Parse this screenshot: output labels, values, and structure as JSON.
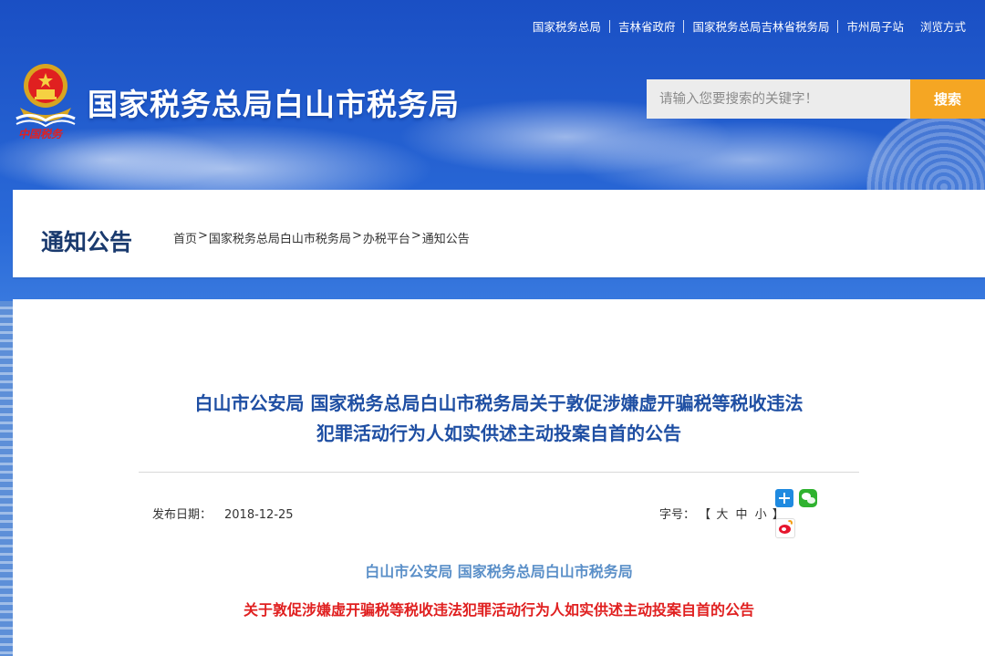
{
  "top_links": [
    "国家税务总局",
    "吉林省政府",
    "国家税务总局吉林省税务局",
    "市州局子站",
    "浏览方式"
  ],
  "header": {
    "site_title": "国家税务总局白山市税务局",
    "logo_caption": "中国税务",
    "logo_icon": "national-emblem-icon"
  },
  "search": {
    "placeholder": "请输入您要搜索的关键字！",
    "button_label": "搜索"
  },
  "section": {
    "title": "通知公告",
    "breadcrumb": [
      "首页",
      "国家税务总局白山市税务局",
      "办税平台",
      "通知公告"
    ],
    "breadcrumb_separator": ">"
  },
  "article": {
    "title_line1": "白山市公安局 国家税务总局白山市税务局关于敦促涉嫌虚开骗税等税收违法",
    "title_line2": "犯罪活动行为人如实供述主动投案自首的公告",
    "date_label": "发布日期：",
    "date_value": "2018-12-25",
    "font_size_label": "字号：",
    "font_size_open": "【",
    "font_size_options": [
      "大",
      "中",
      "小"
    ],
    "font_size_close": "】",
    "share_icons": [
      "share-plus-icon",
      "wechat-icon",
      "weibo-icon"
    ],
    "body_subtitle": "白山市公安局 国家税务总局白山市税务局",
    "body_heading": "关于敦促涉嫌虚开骗税等税收违法犯罪活动行为人如实供述主动投案自首的公告"
  },
  "colors": {
    "banner_blue": "#1a4fc4",
    "search_button": "#f5a623",
    "title_blue": "#1f4fa3",
    "subtitle_blue": "#5a8fc8",
    "heading_red": "#e02020",
    "section_title": "#1a3a6e"
  }
}
